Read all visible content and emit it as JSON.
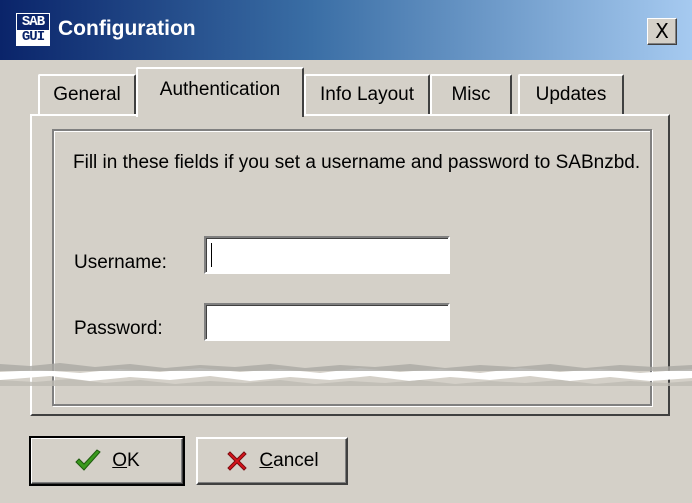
{
  "window": {
    "title": "Configuration",
    "icon_top": "SAB",
    "icon_bottom": "GUI",
    "close_symbol": "X"
  },
  "tabs": [
    {
      "label": "General",
      "active": false
    },
    {
      "label": "Authentication",
      "active": true
    },
    {
      "label": "Info Layout",
      "active": false
    },
    {
      "label": "Misc",
      "active": false
    },
    {
      "label": "Updates",
      "active": false
    }
  ],
  "auth": {
    "info_text": "Fill in these fields if you set a username and password to SABnzbd.",
    "username_label": "Username:",
    "username_value": "",
    "password_label": "Password:",
    "password_value": ""
  },
  "buttons": {
    "ok_mnemonic": "O",
    "ok_rest": "K",
    "cancel_mnemonic": "C",
    "cancel_rest": "ancel"
  },
  "icons": {
    "ok": "check-icon",
    "cancel": "x-mark-icon",
    "app": "sabgui-logo-icon"
  },
  "colors": {
    "title_start": "#0a246a",
    "title_end": "#a6caf0",
    "face": "#d4d0c8",
    "check_green": "#3a9a1e",
    "cancel_red": "#d8141c"
  }
}
